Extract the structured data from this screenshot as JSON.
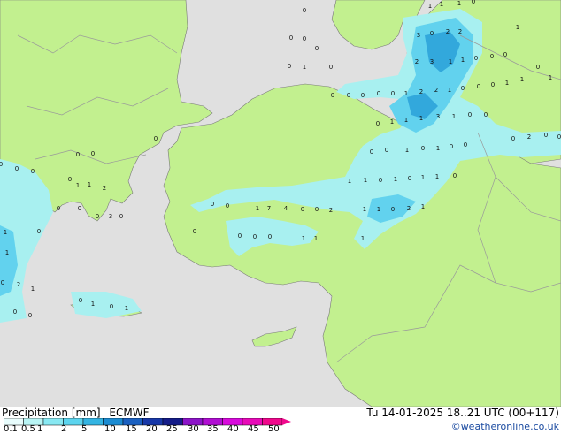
{
  "map": {
    "colors": {
      "sea": "#e0e0e0",
      "land": "#c2f08f",
      "border": "#9a9a9a",
      "coast": "#7a7a7a",
      "precip_light": "#a8f0f0",
      "precip_mid": "#62d2ee",
      "precip_strong": "#32a8dc"
    },
    "values": [
      "1",
      "1",
      "1",
      "0",
      "0",
      "3",
      "0",
      "2",
      "2",
      "0",
      "0",
      "1",
      "0",
      "2",
      "3",
      "1",
      "1",
      "0",
      "0",
      "0",
      "0",
      "1",
      "0",
      "0",
      "1",
      "1",
      "0",
      "0",
      "0",
      "0",
      "0",
      "1",
      "2",
      "2",
      "1",
      "0",
      "0",
      "0",
      "1",
      "0",
      "0",
      "1",
      "1",
      "1",
      "3",
      "1",
      "0",
      "0",
      "0",
      "2",
      "0",
      "0",
      "0",
      "0",
      "0",
      "0",
      "1",
      "0",
      "1",
      "0",
      "0",
      "0",
      "0",
      "0",
      "0",
      "1",
      "1",
      "2",
      "1",
      "1",
      "0",
      "1",
      "0",
      "1",
      "1",
      "0",
      "0",
      "0",
      "1",
      "7",
      "4",
      "0",
      "0",
      "2",
      "1",
      "1",
      "0",
      "2",
      "1",
      "0",
      "0",
      "3",
      "0",
      "0",
      "0",
      "0",
      "0",
      "0",
      "1",
      "1",
      "1",
      "0",
      "1",
      "1",
      "0",
      "2",
      "1",
      "0",
      "1",
      "0",
      "1",
      "0",
      "0"
    ]
  },
  "legend": {
    "title": "Precipitation [mm]",
    "model": "ECMWF",
    "ticks": [
      "0.1",
      "0.5",
      "1",
      "2",
      "5",
      "10",
      "15",
      "20",
      "25",
      "30",
      "35",
      "40",
      "45",
      "50"
    ],
    "colors": [
      "#e8fcfc",
      "#b8f4f4",
      "#88e8f2",
      "#5cd4ee",
      "#34b4e2",
      "#1c8cd2",
      "#1a60c0",
      "#1838a8",
      "#141c88",
      "#8c14c8",
      "#b00ed2",
      "#d80adc",
      "#e80ab8",
      "#f0088c"
    ]
  },
  "footer": {
    "datetime": "Tu 14-01-2025 18..21 UTC (00+117)",
    "credit": "©weatheronline.co.uk"
  }
}
